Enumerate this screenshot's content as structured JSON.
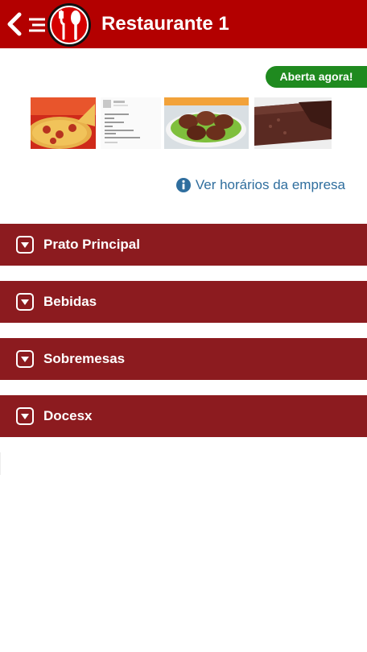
{
  "header": {
    "title": "Restaurante 1",
    "back_icon": "chevron-left-icon",
    "logo_icon": "fork-knife-logo-icon",
    "background_color": "#b30000"
  },
  "status": {
    "badge_label": "Aberta agora!",
    "badge_color": "#1f8a1f"
  },
  "gallery": {
    "images": [
      {
        "name": "pizza-photo"
      },
      {
        "name": "text-screenshot-thumb"
      },
      {
        "name": "meatballs-photo"
      },
      {
        "name": "chocolate-cake-photo"
      }
    ]
  },
  "hours_link": {
    "label": "Ver horários da empresa",
    "icon": "info-circle-icon",
    "color": "#2f6e9e"
  },
  "categories": [
    {
      "label": "Prato Principal"
    },
    {
      "label": "Bebidas"
    },
    {
      "label": "Sobremesas"
    },
    {
      "label": "Docesx"
    }
  ],
  "category_color": "#8c1b1f"
}
